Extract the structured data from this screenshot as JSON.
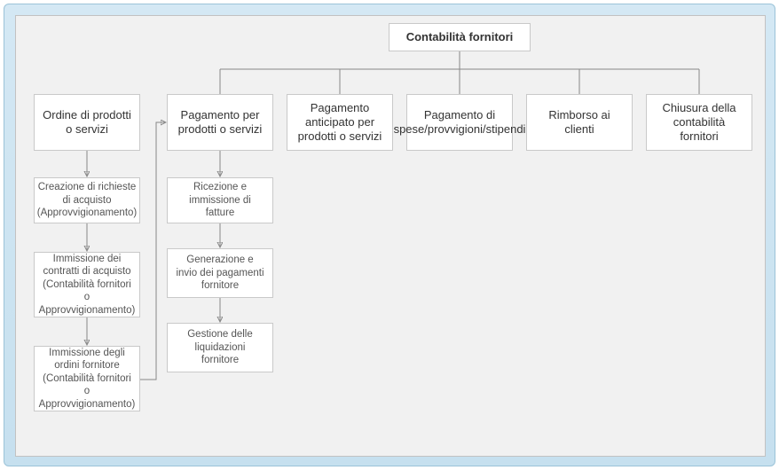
{
  "root": {
    "title": "Contabilità fornitori"
  },
  "categories": {
    "c0": "Ordine di prodotti o servizi",
    "c1": "Pagamento per prodotti o servizi",
    "c2": "Pagamento anticipato per prodotti o servizi",
    "c3": "Pagamento di spese/provvigioni/stipendi",
    "c4": "Rimborso ai clienti",
    "c5": "Chiusura della contabilità fornitori"
  },
  "col0_steps": {
    "s0": "Creazione di richieste di acquisto (Approvvigionamento)",
    "s1": "Immissione dei contratti di acquisto (Contabilità fornitori o Approvvigionamento)",
    "s2": "Immissione degli ordini fornitore (Contabilità fornitori o Approvvigionamento)"
  },
  "col1_steps": {
    "s0": "Ricezione e immissione di fatture",
    "s1": "Generazione e invio dei pagamenti fornitore",
    "s2": "Gestione delle liquidazioni fornitore"
  }
}
